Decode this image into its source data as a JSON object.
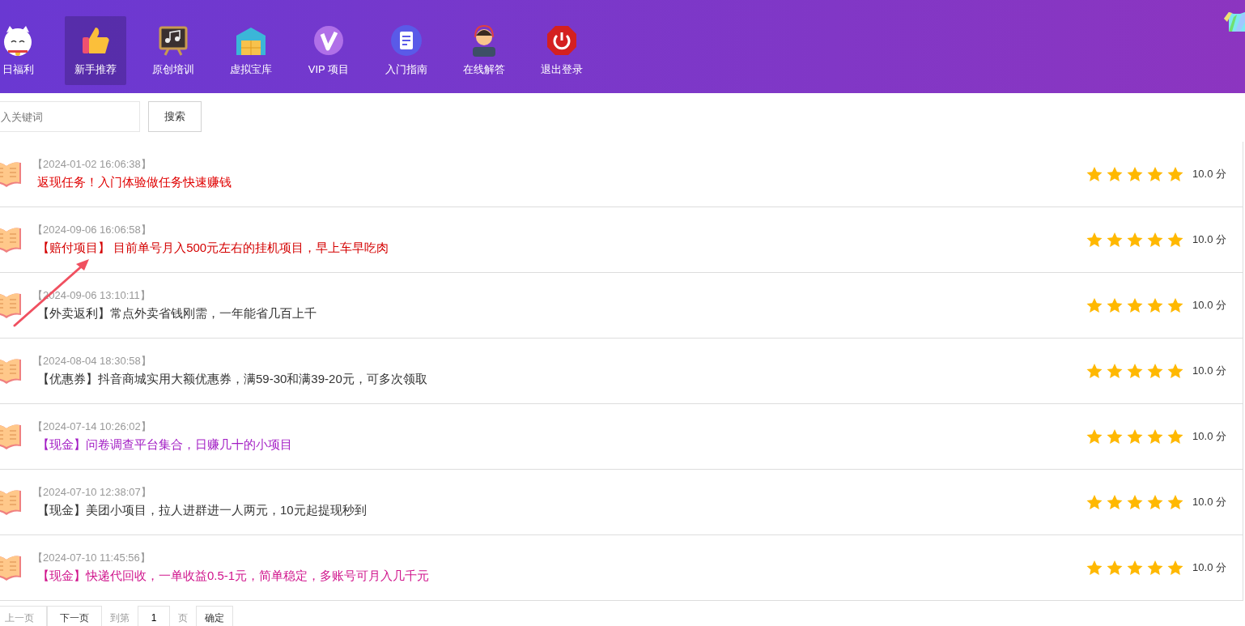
{
  "nav": [
    {
      "label": "日福利",
      "selected": false
    },
    {
      "label": "新手推荐",
      "selected": true
    },
    {
      "label": "原创培训",
      "selected": false
    },
    {
      "label": "虚拟宝库",
      "selected": false
    },
    {
      "label": "VIP 项目",
      "selected": false
    },
    {
      "label": "入门指南",
      "selected": false
    },
    {
      "label": "在线解答",
      "selected": false
    },
    {
      "label": "退出登录",
      "selected": false
    }
  ],
  "search": {
    "placeholder": "入关键词",
    "button": "搜索"
  },
  "articles": [
    {
      "time": "【2024-01-02 16:06:38】",
      "title": "返现任务！入门体验做任务快速赚钱",
      "color": "#e00000",
      "stars": 5,
      "score": "10.0 分"
    },
    {
      "time": "【2024-09-06 16:06:58】",
      "title": "【赔付项目】 目前单号月入500元左右的挂机项目，早上车早吃肉",
      "color": "#d40000",
      "stars": 5,
      "score": "10.0 分"
    },
    {
      "time": "【2024-09-06 13:10:11】",
      "title": "【外卖返利】常点外卖省钱刚需，一年能省几百上千",
      "color": "#333333",
      "stars": 5,
      "score": "10.0 分"
    },
    {
      "time": "【2024-08-04 18:30:58】",
      "title": "【优惠券】抖音商城实用大额优惠券，满59-30和满39-20元，可多次领取",
      "color": "#333333",
      "stars": 5,
      "score": "10.0 分"
    },
    {
      "time": "【2024-07-14 10:26:02】",
      "title": "【现金】问卷调查平台集合，日赚几十的小项目",
      "color": "#a21cc4",
      "stars": 5,
      "score": "10.0 分"
    },
    {
      "time": "【2024-07-10 12:38:07】",
      "title": "【现金】美团小项目，拉人进群进一人两元，10元起提现秒到",
      "color": "#333333",
      "stars": 5,
      "score": "10.0 分"
    },
    {
      "time": "【2024-07-10 11:45:56】",
      "title": "【现金】快递代回收，一单收益0.5-1元，简单稳定，多账号可月入几千元",
      "color": "#d0148c",
      "stars": 5,
      "score": "10.0 分"
    }
  ],
  "pagination": {
    "prev": {
      "label": "上一页",
      "disabled": true
    },
    "next": {
      "label": "下一页",
      "disabled": false
    },
    "goto": "到第",
    "page": "1",
    "unit": "页",
    "confirm": "确定"
  }
}
